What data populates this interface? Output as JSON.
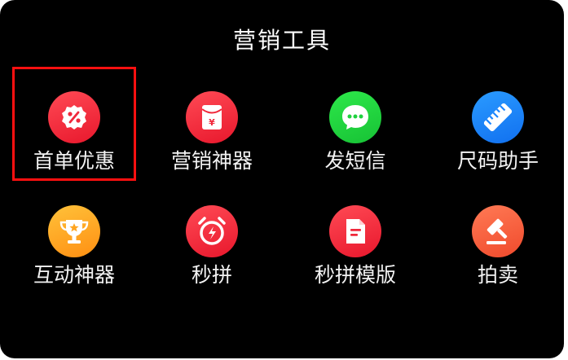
{
  "panel": {
    "title": "营销工具"
  },
  "tools": [
    {
      "label": "首单优惠",
      "icon": "discount-badge-icon",
      "color": "#f0283b",
      "selected": true
    },
    {
      "label": "营销神器",
      "icon": "red-envelope-icon",
      "color": "#f0283b",
      "selected": false
    },
    {
      "label": "发短信",
      "icon": "chat-bubble-icon",
      "color": "#1fd23e",
      "selected": false
    },
    {
      "label": "尺码助手",
      "icon": "ruler-icon",
      "color": "#1a85ff",
      "selected": false
    },
    {
      "label": "互动神器",
      "icon": "trophy-icon",
      "color": "#ffa520",
      "selected": false
    },
    {
      "label": "秒拼",
      "icon": "alarm-clock-icon",
      "color": "#f0283b",
      "selected": false
    },
    {
      "label": "秒拼模版",
      "icon": "document-template-icon",
      "color": "#f0283b",
      "selected": false
    },
    {
      "label": "拍卖",
      "icon": "auction-hammer-icon",
      "color": "#f25a35",
      "selected": false
    }
  ],
  "selection_color": "#ff1010"
}
